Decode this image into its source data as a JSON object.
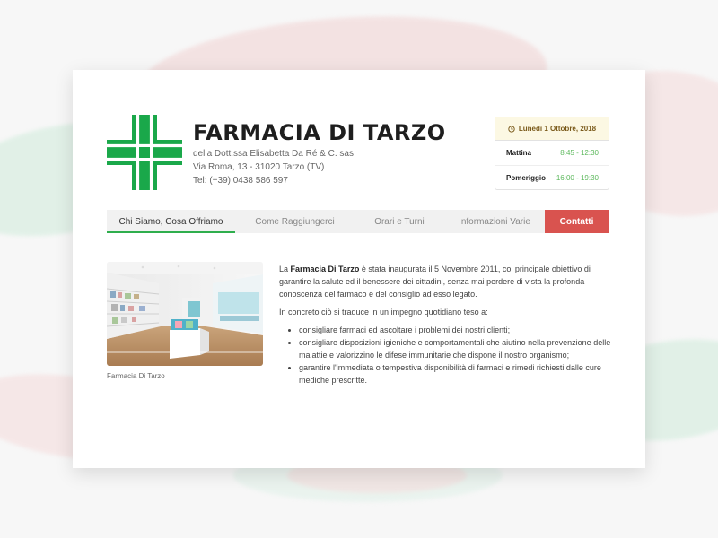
{
  "header": {
    "title": "FARMACIA DI TARZO",
    "subtitle": "della Dott.ssa Elisabetta Da Ré & C. sas",
    "address": "Via Roma, 13 - 31020 Tarzo (TV)",
    "phone": "Tel: (+39) 0438 586 597"
  },
  "hours": {
    "date": "Lunedì 1 Ottobre, 2018",
    "rows": [
      {
        "label": "Mattina",
        "value": "8:45 - 12:30"
      },
      {
        "label": "Pomeriggio",
        "value": "16:00 - 19:30"
      }
    ]
  },
  "nav": {
    "tabs": [
      {
        "label": "Chi Siamo, Cosa Offriamo",
        "active": true
      },
      {
        "label": "Come Raggiungerci"
      },
      {
        "label": "Orari e Turni"
      },
      {
        "label": "Informazioni Varie"
      },
      {
        "label": "Contatti"
      }
    ]
  },
  "content": {
    "caption": "Farmacia Di Tarzo",
    "p1_pre": "La ",
    "p1_bold": "Farmacia Di Tarzo",
    "p1_post": " è stata inaugurata il 5 Novembre 2011, col principale obiettivo di garantire la salute ed il benessere dei cittadini, senza mai perdere di vista la profonda conoscenza del farmaco e del consiglio ad esso legato.",
    "p2": "In concreto ciò si traduce in un impegno quotidiano teso a:",
    "bullets": [
      "consigliare farmaci ed ascoltare i problemi dei nostri clienti;",
      "consigliare disposizioni igieniche e comportamentali che aiutino nella prevenzione delle malattie e valorizzino le difese immunitarie che dispone il nostro organismo;",
      "garantire l'immediata o tempestiva disponibilità di farmaci e rimedi richiesti dalle cure mediche prescritte."
    ]
  },
  "colors": {
    "green": "#1aa84a",
    "red": "#d9534f",
    "hours_header_bg": "#fcf8e3"
  },
  "icons": [
    "pharmacy-cross-icon",
    "clock-icon"
  ]
}
